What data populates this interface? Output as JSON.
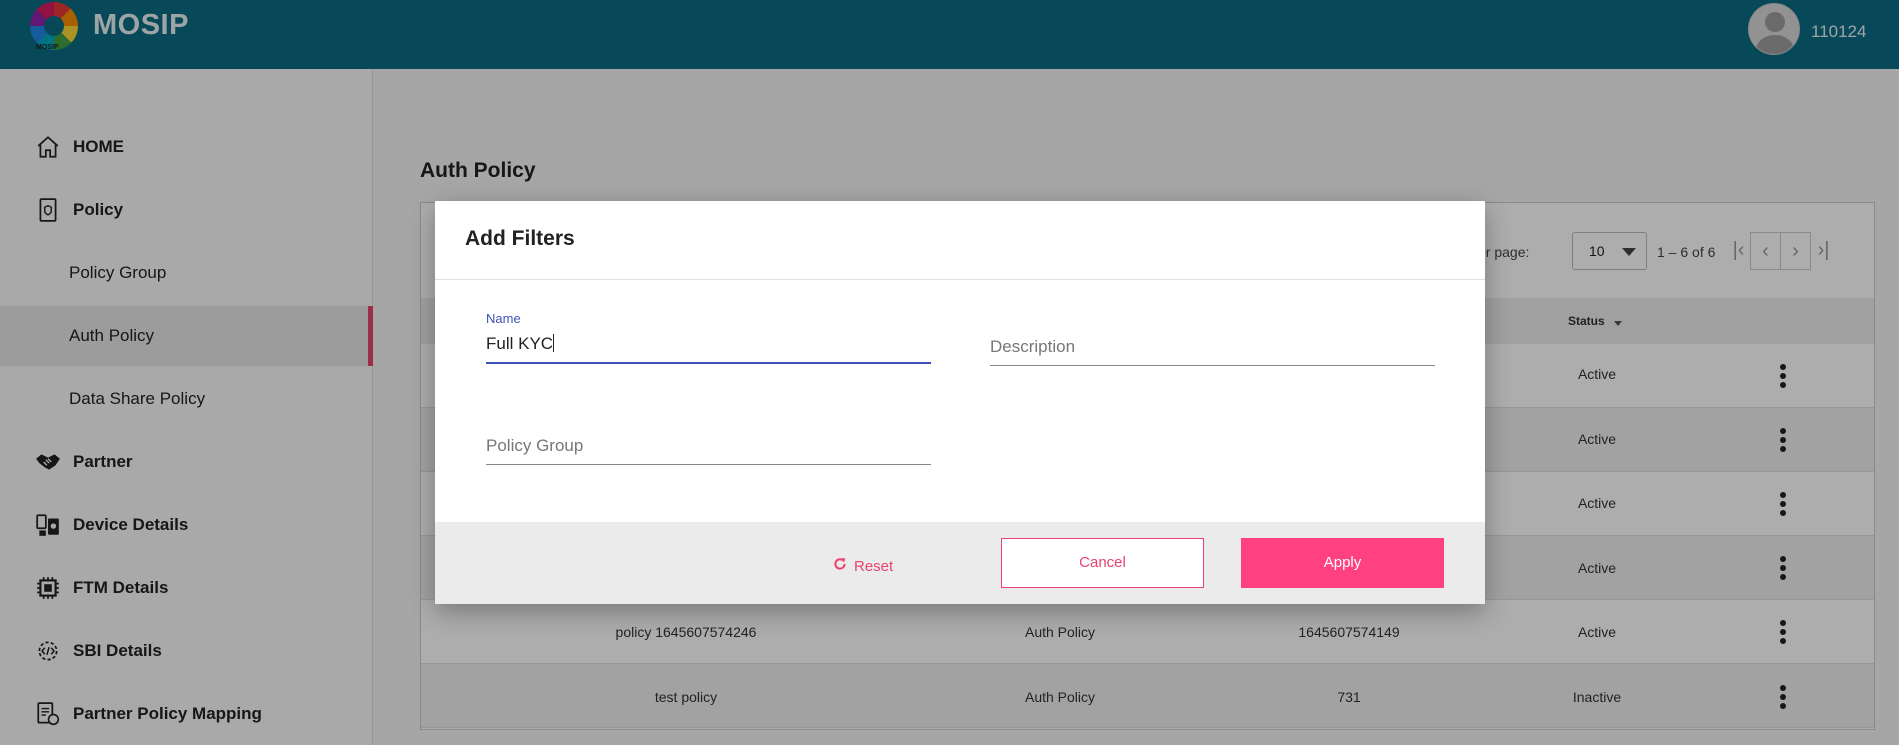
{
  "header": {
    "logo_small_text": "MOSIP",
    "brand": "MOSIP",
    "user_id": "110124"
  },
  "sidebar": {
    "items": [
      {
        "label": "HOME",
        "icon": "home-icon",
        "level": "main"
      },
      {
        "label": "Policy",
        "icon": "policy-document-icon",
        "level": "main"
      },
      {
        "label": "Policy Group",
        "level": "sub"
      },
      {
        "label": "Auth Policy",
        "level": "sub",
        "active": true
      },
      {
        "label": "Data Share Policy",
        "level": "sub"
      },
      {
        "label": "Partner",
        "icon": "handshake-icon",
        "level": "main"
      },
      {
        "label": "Device Details",
        "icon": "device-icon",
        "level": "main"
      },
      {
        "label": "FTM Details",
        "icon": "chip-icon",
        "level": "main"
      },
      {
        "label": "SBI Details",
        "icon": "code-gear-icon",
        "level": "main"
      },
      {
        "label": "Partner Policy Mapping",
        "icon": "mapping-document-icon",
        "level": "main"
      }
    ]
  },
  "main": {
    "title": "Auth Policy",
    "pager": {
      "label": "er page:",
      "page_size": "10",
      "range": "1 – 6 of 6"
    },
    "table": {
      "status_header": "Status",
      "rows": [
        {
          "name": "",
          "type": "",
          "group": "",
          "status": "Active"
        },
        {
          "name": "",
          "type": "",
          "group": "",
          "status": "Active"
        },
        {
          "name": "",
          "type": "",
          "group": "",
          "status": "Active"
        },
        {
          "name": "",
          "type": "",
          "group": "",
          "status": "Active"
        },
        {
          "name": "policy 1645607574246",
          "type": "Auth Policy",
          "group": "1645607574149",
          "status": "Active"
        },
        {
          "name": "test policy",
          "type": "Auth Policy",
          "group": "731",
          "status": "Inactive"
        }
      ]
    }
  },
  "dialog": {
    "title": "Add Filters",
    "name_label": "Name",
    "name_value": "Full KYC",
    "description_placeholder": "Description",
    "policy_group_placeholder": "Policy Group",
    "reset_label": "Reset",
    "cancel_label": "Cancel",
    "apply_label": "Apply"
  },
  "colors": {
    "header_bg": "#0d6c84",
    "accent_pink": "#ff4081",
    "focus_blue": "#3f51b5"
  }
}
